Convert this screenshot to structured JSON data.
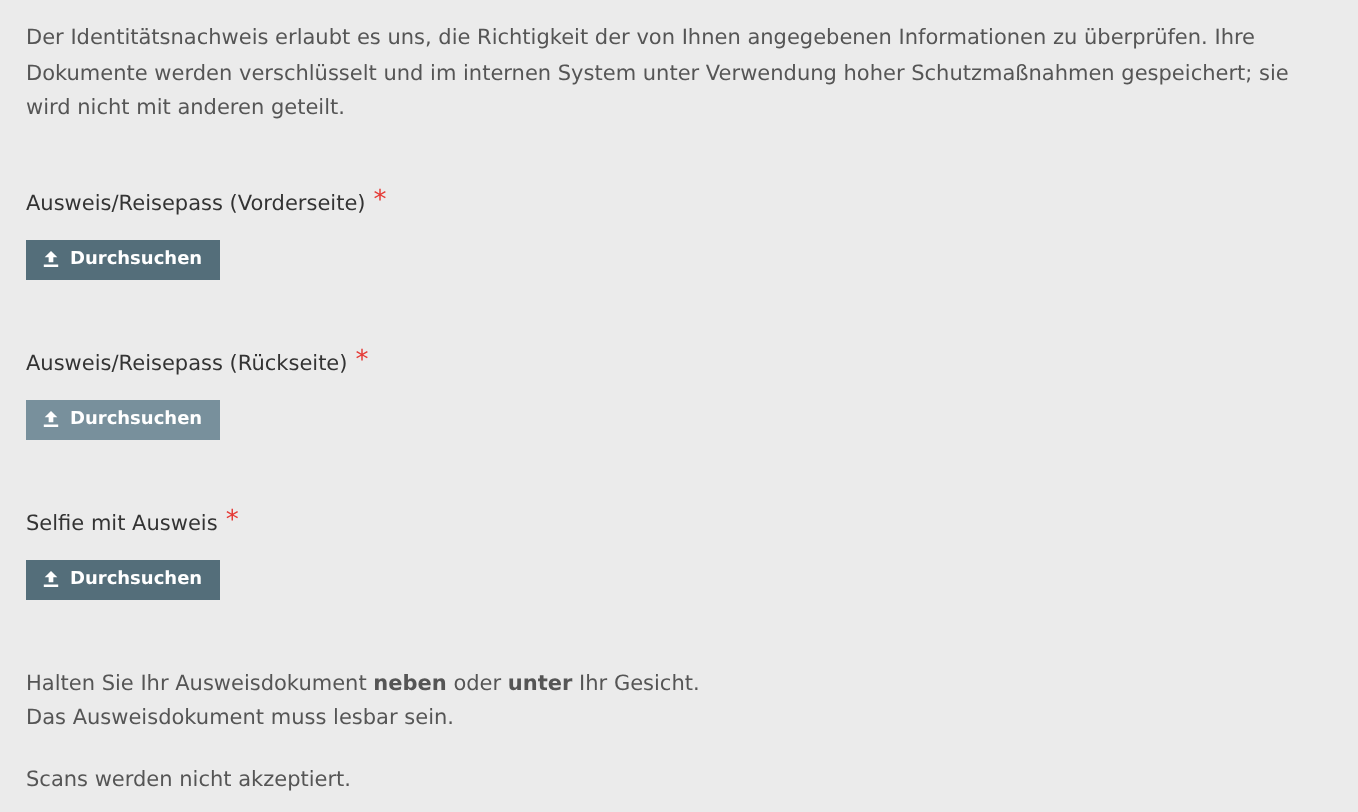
{
  "intro": "Der Identitätsnachweis erlaubt es uns, die Richtigkeit der von Ihnen angegebenen Informationen zu überprüfen. Ihre Dokumente werden verschlüsselt und im internen System unter Verwendung hoher Schutzmaßnahmen gespeichert; sie wird nicht mit anderen geteilt.",
  "uploads": [
    {
      "label": "Ausweis/Reisepass (Vorderseite)",
      "required_mark": "*",
      "button": "Durchsuchen",
      "hovered": false
    },
    {
      "label": "Ausweis/Reisepass (Rückseite)",
      "required_mark": "*",
      "button": "Durchsuchen",
      "hovered": true
    },
    {
      "label": "Selfie mit Ausweis",
      "required_mark": "*",
      "button": "Durchsuchen",
      "hovered": false
    }
  ],
  "notes": [
    "Halten Sie Ihr Ausweisdokument **neben** oder **unter** Ihr Gesicht.",
    "Das Ausweisdokument muss lesbar sein."
  ],
  "final_note": "Scans werden nicht akzeptiert."
}
